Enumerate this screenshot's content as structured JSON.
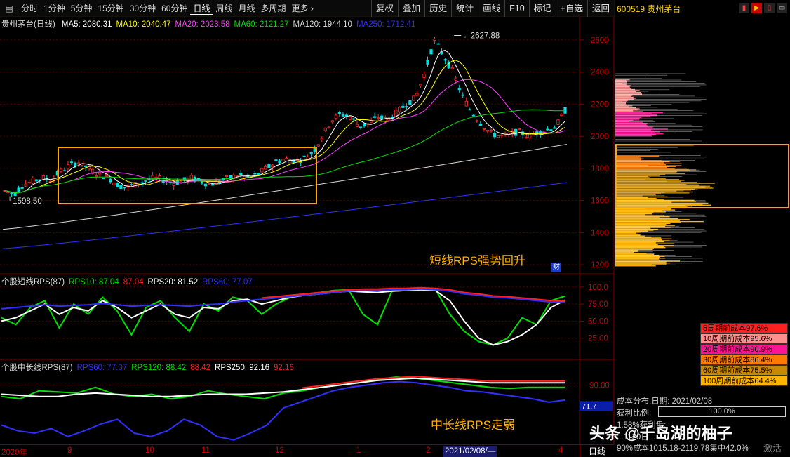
{
  "toolbar": {
    "periods": [
      "分时",
      "1分钟",
      "5分钟",
      "15分钟",
      "30分钟",
      "60分钟",
      "日线",
      "周线",
      "月线",
      "多周期",
      "更多"
    ],
    "active_period": "日线",
    "buttons": [
      "复权",
      "叠加",
      "历史",
      "统计",
      "画线",
      "F10",
      "标记",
      "+自选",
      "返回"
    ]
  },
  "stock": {
    "name_main": "贵州茅台(日线)",
    "code_title": "600519 贵州茅台"
  },
  "ma_legend": [
    {
      "label": "MA5: 2080.31",
      "color": "#ffffff"
    },
    {
      "label": "MA10: 2040.47",
      "color": "#ffff00"
    },
    {
      "label": "MA20: 2023.58",
      "color": "#ff40ff"
    },
    {
      "label": "MA60: 2121.27",
      "color": "#00e000"
    },
    {
      "label": "MA120: 1944.10",
      "color": "#d8d8d8"
    },
    {
      "label": "MA250: 1712.41",
      "color": "#3030ff"
    }
  ],
  "rps_short_legend": [
    {
      "label": "个股短线RPS(87)",
      "color": "#d8d8d8"
    },
    {
      "label": "RPS10: 87.04",
      "color": "#00e000"
    },
    {
      "label": "87.04",
      "color": "#ff2020"
    },
    {
      "label": "RPS20: 81.52",
      "color": "#ffffff"
    },
    {
      "label": "RPS60: 77.07",
      "color": "#3030ff"
    }
  ],
  "rps_long_legend": [
    {
      "label": "个股中长线RPS(87)",
      "color": "#d8d8d8"
    },
    {
      "label": "RPS60: 77.07",
      "color": "#3030ff"
    },
    {
      "label": "RPS120: 88.42",
      "color": "#00e000"
    },
    {
      "label": "88.42",
      "color": "#ff2020"
    },
    {
      "label": "RPS250: 92.16",
      "color": "#ffffff"
    },
    {
      "label": "92.16",
      "color": "#ff2020"
    }
  ],
  "main_axis_labels": [
    "2600",
    "2400",
    "2200",
    "2000",
    "1800",
    "1600",
    "1400",
    "1200"
  ],
  "short_axis_labels": [
    "100.0",
    "75.00",
    "50.00",
    "25.00"
  ],
  "long_axis_labels": [
    "90.00"
  ],
  "long_current": "71.7",
  "price_marks": {
    "high": "2627.88",
    "low": "1598.50"
  },
  "annotations": {
    "short": "短线RPS强势回升",
    "long": "中长线RPS走弱",
    "fin_badge": "财"
  },
  "time_axis": {
    "labels": [
      "2020年",
      "9",
      "10",
      "11",
      "12",
      "1",
      "2",
      "4"
    ],
    "cursor": "2021/02/08/—",
    "period": "日线"
  },
  "cost_legend": [
    {
      "label": "5周期前成本97.6%",
      "color": "#ff2020"
    },
    {
      "label": "10周期前成本95.6%",
      "color": "#ff9090"
    },
    {
      "label": "20周期前成本90.9%",
      "color": "#ff1493"
    },
    {
      "label": "30周期前成本86.4%",
      "color": "#ff7a00"
    },
    {
      "label": "60周期前成本75.5%",
      "color": "#c88a00"
    },
    {
      "label": "100周期前成本64.4%",
      "color": "#ffb400"
    }
  ],
  "cost_info": {
    "date_line": "成本分布,日期:  2021/02/08",
    "profit_label": "获利比例:",
    "profit_value": "100.0%",
    "line3": "1.58%获利盘:",
    "line4": "...1120日...",
    "line5": "90%成本1015.18-2119.78集中42.0%"
  },
  "watermark": {
    "text": "头条 @千岛湖的柚子",
    "corner": "激活"
  },
  "chart_data": [
    {
      "type": "candlestick",
      "title": "贵州茅台(日线)",
      "period": "daily",
      "ylim": [
        1170,
        2700
      ],
      "yticks": [
        1200,
        1400,
        1600,
        1800,
        2000,
        2200,
        2400,
        2600
      ],
      "high_mark": 2627.88,
      "low_mark": 1598.5,
      "x_labels": [
        "2020年",
        "9",
        "10",
        "11",
        "12",
        "1",
        "2",
        "4"
      ],
      "close_path": [
        1660,
        1640,
        1700,
        1720,
        1740,
        1730,
        1780,
        1820,
        1840,
        1800,
        1760,
        1750,
        1700,
        1680,
        1700,
        1720,
        1740,
        1730,
        1710,
        1720,
        1740,
        1720,
        1700,
        1720,
        1740,
        1760,
        1740,
        1760,
        1800,
        1840,
        1860,
        1850,
        1860,
        1900,
        2000,
        2100,
        2140,
        2120,
        2060,
        2080,
        2120,
        2100,
        2150,
        2200,
        2240,
        2400,
        2600,
        2500,
        2400,
        2250,
        2150,
        2080,
        2020,
        2000,
        2010,
        2030,
        2000,
        2020,
        2040,
        2060,
        2160
      ]
    },
    {
      "type": "line",
      "title": "个股短线RPS(87)",
      "ylim": [
        0,
        105
      ],
      "series": [
        {
          "name": "RPS10",
          "color": "#00e000",
          "values": [
            55,
            45,
            70,
            80,
            40,
            75,
            60,
            85,
            65,
            30,
            70,
            80,
            55,
            35,
            75,
            65,
            85,
            80,
            60,
            75,
            85,
            90,
            92,
            95,
            96,
            60,
            45,
            94,
            95,
            96,
            97,
            60,
            35,
            20,
            15,
            25,
            55,
            45,
            80,
            87
          ]
        },
        {
          "name": "RPS20",
          "color": "#ffffff",
          "values": [
            50,
            55,
            65,
            75,
            60,
            70,
            65,
            80,
            70,
            55,
            65,
            75,
            60,
            55,
            70,
            68,
            80,
            82,
            75,
            80,
            85,
            88,
            90,
            92,
            94,
            93,
            92,
            94,
            95,
            96,
            95,
            80,
            50,
            25,
            15,
            20,
            30,
            45,
            70,
            81
          ]
        },
        {
          "name": "RPS60",
          "color": "#3030ff",
          "values": [
            68,
            70,
            72,
            74,
            72,
            73,
            74,
            76,
            74,
            72,
            73,
            74,
            73,
            72,
            74,
            75,
            78,
            80,
            82,
            84,
            86,
            88,
            90,
            92,
            94,
            95,
            95,
            96,
            96,
            97,
            96,
            94,
            90,
            88,
            85,
            84,
            82,
            80,
            78,
            77
          ]
        }
      ]
    },
    {
      "type": "line",
      "title": "个股中长线RPS(87)",
      "ylim": [
        40,
        105
      ],
      "series": [
        {
          "name": "RPS60",
          "color": "#3030ff",
          "values": [
            55,
            50,
            48,
            52,
            45,
            50,
            56,
            60,
            48,
            45,
            50,
            60,
            55,
            45,
            42,
            48,
            55,
            70,
            75,
            80,
            85,
            88,
            90,
            92,
            93,
            92,
            90,
            88,
            85,
            84,
            82,
            80,
            78,
            75,
            77
          ]
        },
        {
          "name": "RPS120",
          "color": "#00e000",
          "values": [
            80,
            78,
            85,
            84,
            83,
            88,
            82,
            80,
            82,
            78,
            80,
            85,
            82,
            80,
            78,
            83,
            85,
            88,
            90,
            92,
            95,
            97,
            96,
            94,
            92,
            90,
            88,
            87,
            88,
            88,
            88
          ]
        },
        {
          "name": "RPS250",
          "color": "#ffffff",
          "values": [
            82,
            81,
            80,
            80,
            82,
            83,
            82,
            81,
            80,
            80,
            81,
            82,
            82,
            82,
            83,
            84,
            86,
            88,
            90,
            92,
            94,
            95,
            96,
            95,
            94,
            93,
            92,
            92,
            92,
            92,
            92
          ]
        }
      ]
    }
  ]
}
